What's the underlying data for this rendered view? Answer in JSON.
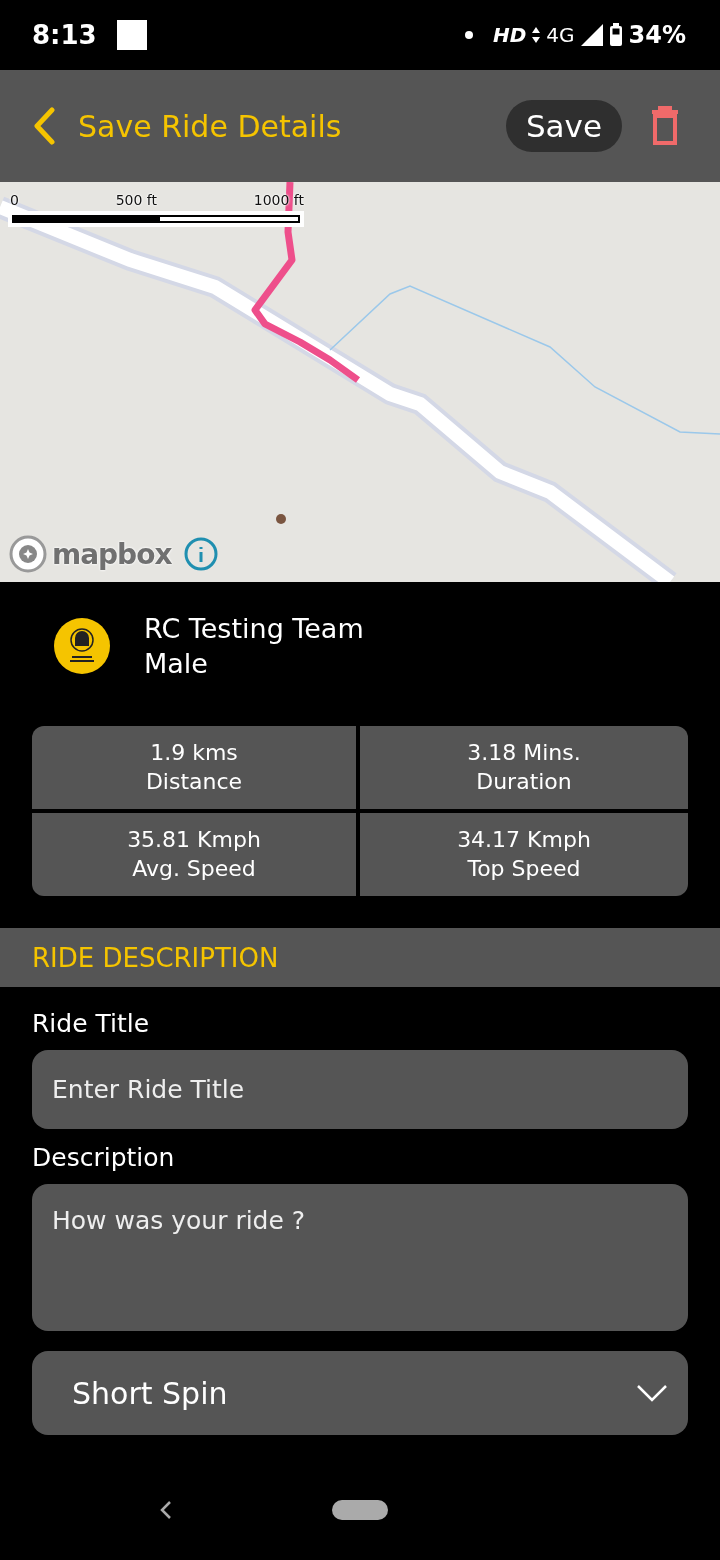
{
  "status_bar": {
    "time": "8:13",
    "hd": "HD",
    "network": "4G",
    "battery": "34%"
  },
  "header": {
    "title": "Save Ride Details",
    "save": "Save"
  },
  "map": {
    "kind": "picture",
    "scale": [
      "0",
      "500 ft",
      "1000 ft"
    ],
    "attribution": "mapbox"
  },
  "profile": {
    "name": "RC Testing Team",
    "gender": "Male"
  },
  "stats": [
    {
      "value": "1.9 kms",
      "label": "Distance"
    },
    {
      "value": "3.18 Mins.",
      "label": "Duration"
    },
    {
      "value": "35.81 Kmph",
      "label": "Avg. Speed"
    },
    {
      "value": "34.17 Kmph",
      "label": "Top Speed"
    }
  ],
  "section": "RIDE DESCRIPTION",
  "form": {
    "title_label": "Ride Title",
    "title_placeholder": "Enter Ride Title",
    "description_label": "Description",
    "description_placeholder": "How was your ride ?",
    "ride_type": "Short Spin"
  }
}
